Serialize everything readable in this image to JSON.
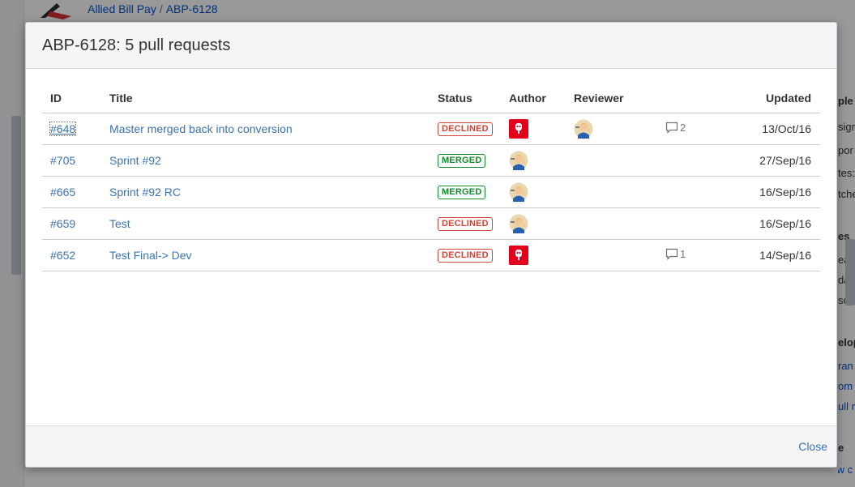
{
  "background": {
    "breadcrumb": {
      "project": "Allied Bill Pay",
      "separator": "/",
      "issue": "ABP-6128"
    },
    "side_fragments": [
      "ple",
      "sign",
      "por",
      "tes:",
      "tche",
      "es",
      "eate",
      "date",
      "solv",
      "elop",
      "ran",
      "om",
      "ull r",
      "e",
      "view c"
    ]
  },
  "dialog": {
    "title": "ABP-6128: 5 pull requests",
    "columns": {
      "id": "ID",
      "title": "Title",
      "status": "Status",
      "author": "Author",
      "reviewer": "Reviewer",
      "updated": "Updated"
    },
    "rows": [
      {
        "id": "#648",
        "title": "Master merged back into conversion",
        "status": "DECLINED",
        "author_avatar": "red-robot",
        "reviewer_avatar": "vault-boy",
        "comments": "2",
        "updated": "13/Oct/16"
      },
      {
        "id": "#705",
        "title": "Sprint #92",
        "status": "MERGED",
        "author_avatar": "vault-boy",
        "reviewer_avatar": "",
        "comments": "",
        "updated": "27/Sep/16"
      },
      {
        "id": "#665",
        "title": "Sprint #92 RC",
        "status": "MERGED",
        "author_avatar": "vault-boy",
        "reviewer_avatar": "",
        "comments": "",
        "updated": "16/Sep/16"
      },
      {
        "id": "#659",
        "title": "Test",
        "status": "DECLINED",
        "author_avatar": "vault-boy",
        "reviewer_avatar": "",
        "comments": "",
        "updated": "16/Sep/16"
      },
      {
        "id": "#652",
        "title": "Test Final-> Dev",
        "status": "DECLINED",
        "author_avatar": "red-robot",
        "reviewer_avatar": "",
        "comments": "1",
        "updated": "14/Sep/16"
      }
    ],
    "close_label": "Close"
  },
  "colors": {
    "link": "#3b73af",
    "declined": "#d04437",
    "merged": "#14892c",
    "overlay": "#000000"
  }
}
